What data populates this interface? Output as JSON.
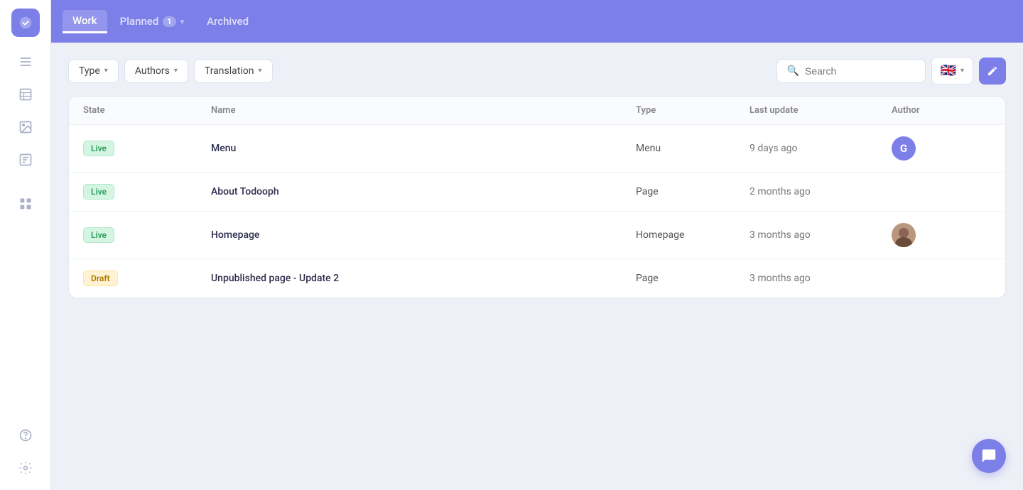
{
  "sidebar": {
    "logo_label": "Logo",
    "icons": [
      {
        "name": "menu-icon",
        "label": "Menu"
      },
      {
        "name": "table-icon",
        "label": "Table"
      },
      {
        "name": "image-icon",
        "label": "Image"
      },
      {
        "name": "form-icon",
        "label": "Form"
      },
      {
        "name": "grid-icon",
        "label": "Grid"
      }
    ],
    "bottom_icons": [
      {
        "name": "help-icon",
        "label": "Help"
      },
      {
        "name": "settings-icon",
        "label": "Settings"
      }
    ]
  },
  "topnav": {
    "items": [
      {
        "id": "work",
        "label": "Work",
        "active": true,
        "badge": null
      },
      {
        "id": "planned",
        "label": "Planned",
        "active": false,
        "badge": "1"
      },
      {
        "id": "archived",
        "label": "Archived",
        "active": false,
        "badge": null
      }
    ]
  },
  "filters": {
    "type_label": "Type",
    "authors_label": "Authors",
    "translation_label": "Translation",
    "search_placeholder": "Search",
    "lang_flag": "🇬🇧",
    "edit_label": "Edit"
  },
  "table": {
    "columns": [
      "State",
      "Name",
      "Type",
      "Last update",
      "Author"
    ],
    "rows": [
      {
        "state": "Live",
        "state_class": "live",
        "name": "Menu",
        "type": "Menu",
        "last_update": "9 days ago",
        "author_type": "initial",
        "author_initial": "G",
        "author_color": "g"
      },
      {
        "state": "Live",
        "state_class": "live",
        "name": "About Todooph",
        "type": "Page",
        "last_update": "2 months ago",
        "author_type": "none",
        "author_initial": "",
        "author_color": ""
      },
      {
        "state": "Live",
        "state_class": "live",
        "name": "Homepage",
        "type": "Homepage",
        "last_update": "3 months ago",
        "author_type": "photo",
        "author_initial": "",
        "author_color": ""
      },
      {
        "state": "Draft",
        "state_class": "draft",
        "name": "Unpublished page - Update 2",
        "type": "Page",
        "last_update": "3 months ago",
        "author_type": "none",
        "author_initial": "",
        "author_color": ""
      }
    ]
  },
  "chat": {
    "label": "Chat"
  }
}
